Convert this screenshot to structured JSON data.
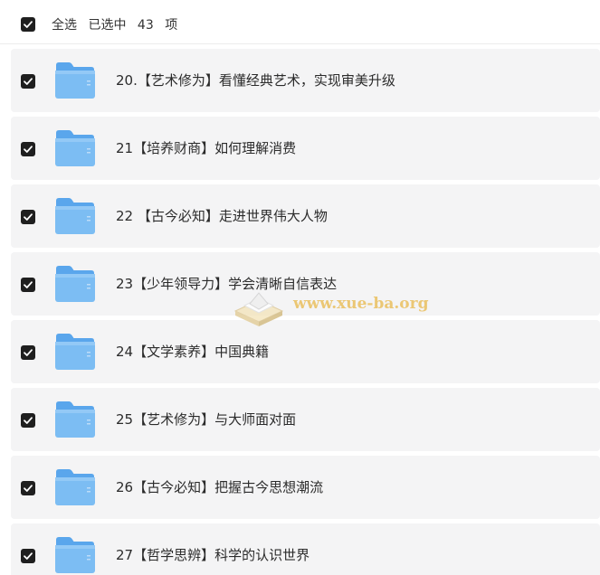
{
  "header": {
    "select_all_label": "全选",
    "selected_prefix": "已选中",
    "selected_count": "43",
    "selected_suffix": "项"
  },
  "items": [
    {
      "label": "20.【艺术修为】看懂经典艺术，实现审美升级",
      "checked": true
    },
    {
      "label": "21【培养财商】如何理解消费",
      "checked": true
    },
    {
      "label": "22 【古今必知】走进世界伟大人物",
      "checked": true
    },
    {
      "label": "23【少年领导力】学会清晰自信表达",
      "checked": true
    },
    {
      "label": "24【文学素养】中国典籍",
      "checked": true
    },
    {
      "label": "25【艺术修为】与大师面对面",
      "checked": true
    },
    {
      "label": "26【古今必知】把握古今思想潮流",
      "checked": true
    },
    {
      "label": "27【哲学思辨】科学的认识世界",
      "checked": true
    }
  ],
  "watermark": {
    "text": "www.xue-ba.org"
  },
  "colors": {
    "checkbox": "#1f1f1f",
    "row_bg": "#f4f4f5",
    "folder": "#6fb4f0",
    "watermark": "#e9b84a"
  }
}
